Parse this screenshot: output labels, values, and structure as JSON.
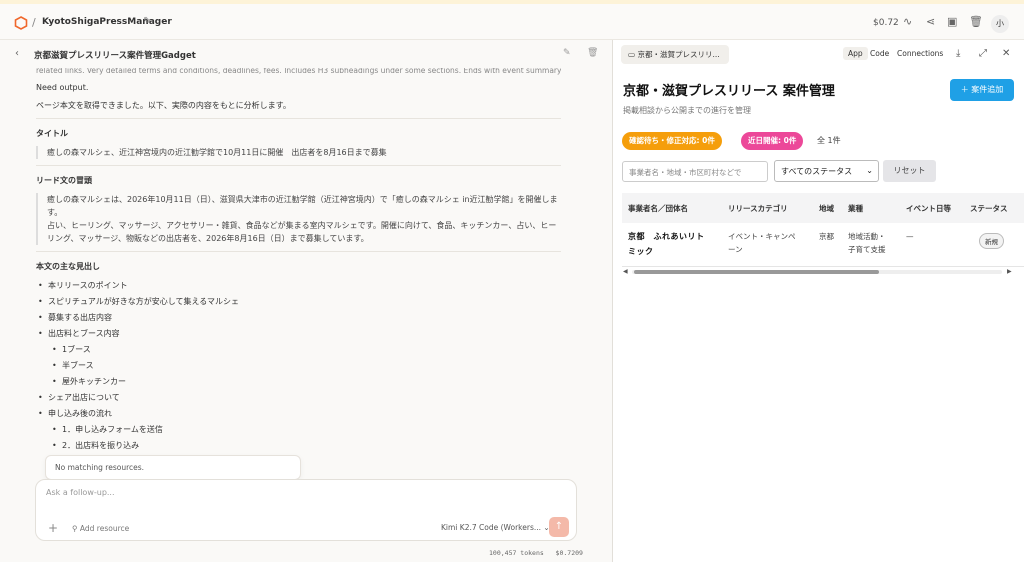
{
  "topbar": {
    "app_name": "KyotoShigaPressManager",
    "cost": "$0.72",
    "avatar_label": "小"
  },
  "chat": {
    "header_title": "京都滋賀プレスリリース案件管理Gadget",
    "faded_line": "related links. Very detailed terms and conditions, deadlines, fees. Includes H3 subheadings under some sections. Ends with event summary table.",
    "need_output": "Need output.",
    "intro": "ページ本文を取得できました。以下、実際の内容をもとに分析します。",
    "title_heading": "タイトル",
    "title_text": "癒しの森マルシェ、近江神宮境内の近江勧学館で10月11日に開催　出店者を8月16日まで募集",
    "lead_heading": "リード文の冒頭",
    "lead_text_1": "癒しの森マルシェは、2026年10月11日（日）、滋賀県大津市の近江勧学館（近江神宮境内）で「癒しの森マルシェ in近江勧学館」を開催します。",
    "lead_text_2": "占い、ヒーリング、マッサージ、アクセサリー・雑貨、食品などが集まる室内マルシェです。開催に向けて、食品、キッチンカー、占い、ヒーリング、マッサージ、物販などの出店者を、2026年8月16日（日）まで募集しています。",
    "headings_heading": "本文の主な見出し",
    "headings": [
      "本リリースのポイント",
      "スピリチュアルが好きな方が安心して集えるマルシェ",
      "募集する出店内容",
      "出店料とブース内容"
    ],
    "sub_headings_1": [
      "1ブース",
      "半ブース",
      "屋外キッチンカー"
    ],
    "headings_2": [
      "シェア出店について",
      "申し込み後の流れ"
    ],
    "sub_headings_2": [
      "1．申し込みフォームを送信",
      "2．出店料を振り込み"
    ],
    "no_matching": "No matching resources.",
    "composer_placeholder": "Ask a follow-up...",
    "add_resource": "Add resource",
    "model": "Kimi K2.7 Code (Workers...",
    "tokens": "100,457 tokens",
    "token_cost": "$0.7209"
  },
  "preview": {
    "tab_label": "京都・滋賀プレスリリ...",
    "seg_app": "App",
    "seg_code": "Code",
    "seg_connections": "Connections",
    "title": "京都・滋賀プレスリリース 案件管理",
    "subtitle": "掲載相談から公開までの進行を管理",
    "add_button": "＋ 案件追加",
    "badge_confirm": "確認待ち・修正対応: 0件",
    "badge_soon": "近日開催: 0件",
    "total_count": "全 1件",
    "search_placeholder": "事業者名・地域・市区町村などで",
    "status_select": "すべてのステータス",
    "reset_button": "リセット",
    "columns": [
      "事業者名／団体名",
      "リリースカテゴリ",
      "地域",
      "業種",
      "イベント日等",
      "ステータス"
    ],
    "rows": [
      {
        "name_1": "京都　ふれあいリト",
        "name_2": "ミック",
        "category_1": "イベント・キャンペ",
        "category_2": "ーン",
        "region": "京都",
        "industry_1": "地域活動・",
        "industry_2": "子育て支援",
        "event_date": "—",
        "status": "新規"
      }
    ],
    "colors": {
      "accent": "#1fa0e6",
      "badge_confirm": "#f59e0b",
      "badge_soon": "#ec4899"
    }
  }
}
